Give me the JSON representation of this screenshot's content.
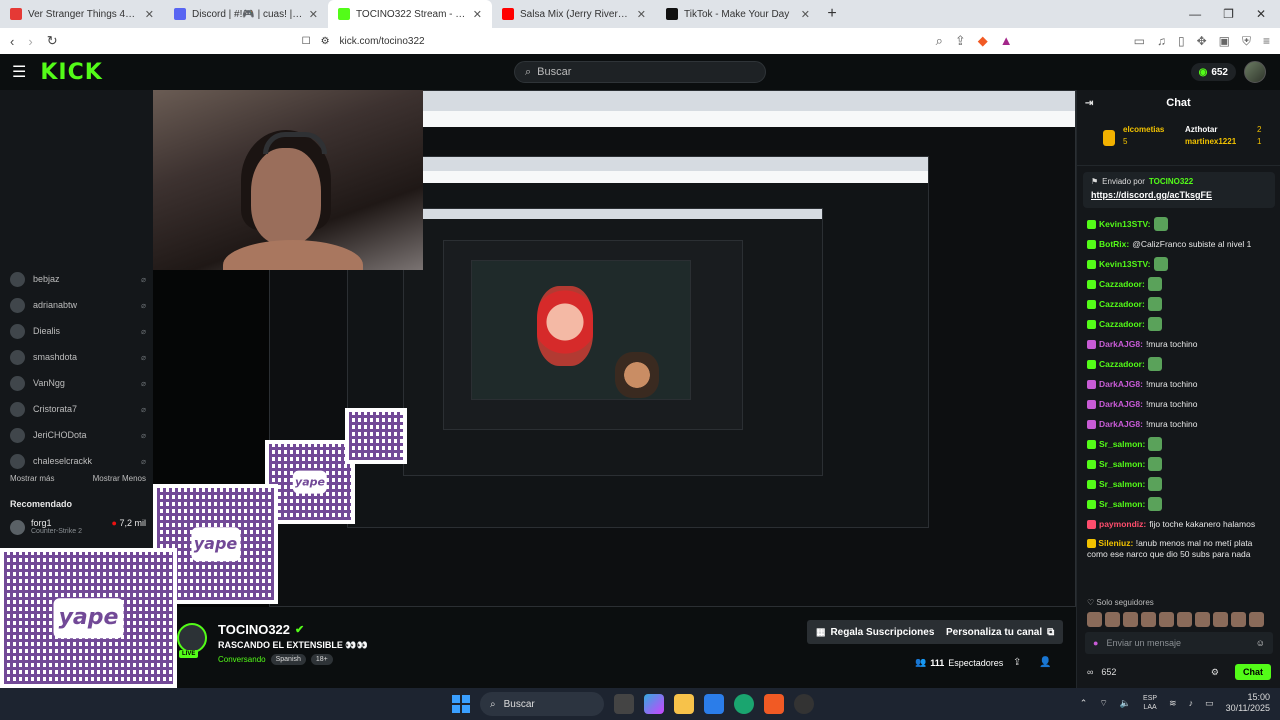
{
  "browser": {
    "tabs": [
      {
        "title": "Ver Stranger Things 4x4 Online Grati",
        "color": "#e53935"
      },
      {
        "title": "Discord | #!🎮 | cuas! | TOCINETA fe",
        "color": "#5865f2"
      },
      {
        "title": "TOCINO322 Stream - Watch Live",
        "color": "#53fc18",
        "active": true
      },
      {
        "title": "Salsa Mix (Jerry Rivera, Frankie Ruiz,",
        "color": "#ff0000"
      },
      {
        "title": "TikTok - Make Your Day",
        "color": "#111111"
      }
    ],
    "url": "kick.com/tocino322"
  },
  "header": {
    "logo": "KICK",
    "search_placeholder": "Buscar",
    "kicks_count": "652"
  },
  "sidebar": {
    "following": [
      {
        "name": "bebjaz"
      },
      {
        "name": "adrianabtw"
      },
      {
        "name": "Diealis"
      },
      {
        "name": "smashdota"
      },
      {
        "name": "VanNgg"
      },
      {
        "name": "Cristorata7"
      },
      {
        "name": "JeriCHODota"
      },
      {
        "name": "chaleselcrackk"
      }
    ],
    "show_more": "Mostrar más",
    "show_less": "Mostrar Menos",
    "recommended_title": "Recomendado",
    "recommended": {
      "name": "forg1",
      "game": "Counter-Strike 2",
      "viewers": "7,2 mil"
    }
  },
  "stream": {
    "qr_label": "yape",
    "channel_name": "TOCINO322",
    "title": "RASCANDO EL EXTENSIBLE 👀👀",
    "category": "Conversando",
    "tags": [
      "Spanish",
      "18+"
    ],
    "live_badge": "LIVE",
    "subs_button": "Regala Suscripciones",
    "customize_button": "Personaliza tu canal",
    "viewers_count": "111",
    "viewers_label": "Espectadores"
  },
  "chat": {
    "title": "Chat",
    "gifters": [
      {
        "name": "elcometias",
        "count": "5"
      },
      {
        "name": "Azthotar",
        "count": "2"
      },
      {
        "name": "martinex1221",
        "count": "1"
      }
    ],
    "pinned_by_label": "Enviado por",
    "pinned_by": "TOCINO322",
    "pinned_link": "https://discord.gg/acTksgFE",
    "messages": [
      {
        "user": "Kevin13STV:",
        "text": "",
        "color": "#53fc18"
      },
      {
        "user": "BotRix:",
        "text": "@CalizFranco subiste al nivel 1",
        "color": "#53fc18"
      },
      {
        "user": "Kevin13STV:",
        "text": "",
        "color": "#53fc18"
      },
      {
        "user": "Cazzadoor:",
        "text": "",
        "color": "#53fc18"
      },
      {
        "user": "Cazzadoor:",
        "text": "",
        "color": "#53fc18"
      },
      {
        "user": "Cazzadoor:",
        "text": "",
        "color": "#53fc18"
      },
      {
        "user": "DarkAJG8:",
        "text": "!mura tochino",
        "color": "#c85bd6"
      },
      {
        "user": "Cazzadoor:",
        "text": "",
        "color": "#53fc18"
      },
      {
        "user": "DarkAJG8:",
        "text": "!mura tochino",
        "color": "#c85bd6"
      },
      {
        "user": "DarkAJG8:",
        "text": "!mura tochino",
        "color": "#c85bd6"
      },
      {
        "user": "DarkAJG8:",
        "text": "!mura tochino",
        "color": "#c85bd6"
      },
      {
        "user": "Sr_salmon:",
        "text": "",
        "color": "#53fc18"
      },
      {
        "user": "Sr_salmon:",
        "text": "",
        "color": "#53fc18"
      },
      {
        "user": "Sr_salmon:",
        "text": "",
        "color": "#53fc18"
      },
      {
        "user": "Sr_salmon:",
        "text": "",
        "color": "#53fc18"
      },
      {
        "user": "paymondiz:",
        "text": "fijo toche kakanero halamos",
        "color": "#ff4d6d"
      },
      {
        "user": "Sileniuz:",
        "text": "!anub menos mal no metí plata como ese narco que dio 50 subs para nada",
        "color": "#f2c200",
        "wrap": true
      }
    ],
    "followers_only": "Solo seguidores",
    "input_placeholder": "Enviar un mensaje",
    "kicks": "652",
    "send_button": "Chat"
  },
  "taskbar": {
    "search": "Buscar",
    "lang_top": "ESP",
    "lang_bottom": "LAA",
    "time": "15:00",
    "date": "30/11/2025"
  }
}
